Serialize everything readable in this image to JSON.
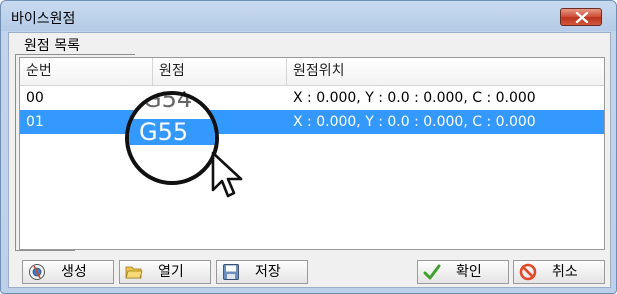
{
  "window": {
    "title": "바이스원점"
  },
  "group": {
    "label": "원점 목록"
  },
  "table": {
    "columns": [
      "순번",
      "원점",
      "원점위치"
    ],
    "rows": [
      {
        "index": "00",
        "origin": "G54",
        "position": "X : 0.000, Y : 0.0 : 0.000, C : 0.000",
        "selected": false
      },
      {
        "index": "01",
        "origin": "G55",
        "position": "X : 0.000, Y : 0.0 : 0.000, C : 0.000",
        "selected": true
      }
    ]
  },
  "magnifier": {
    "text": "G55",
    "ghost_text": "G54"
  },
  "toolbar": {
    "create_label": "생성",
    "open_label": "열기",
    "save_label": "저장",
    "confirm_label": "확인",
    "cancel_label": "취소"
  },
  "colors": {
    "selection": "#3399ff",
    "confirm_check": "#3fa12c",
    "cancel_red": "#e04a2a",
    "close_button": "#c9462f"
  },
  "icons": [
    "close-icon",
    "create-icon",
    "folder-icon",
    "save-disk-icon",
    "checkmark-icon",
    "cancel-icon",
    "mouse-pointer-icon"
  ]
}
